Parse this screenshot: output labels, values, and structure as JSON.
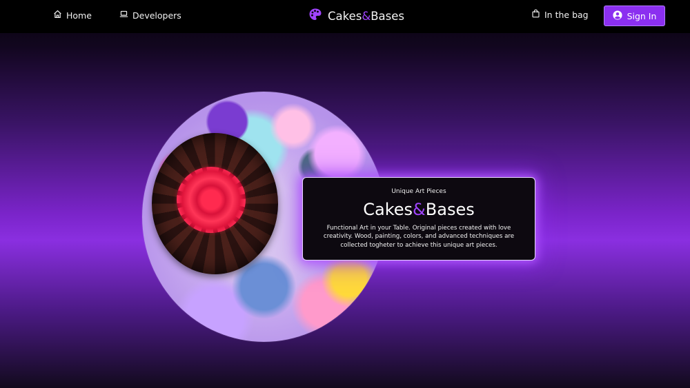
{
  "nav": {
    "home_label": "Home",
    "developers_label": "Developers",
    "bag_label": "In the bag",
    "signin_label": "Sign In"
  },
  "brand": {
    "part1": "Cakes",
    "amp": "&",
    "part2": "Bases"
  },
  "hero_card": {
    "eyebrow": "Unique Art Pieces",
    "title_part1": "Cakes",
    "title_amp": "&",
    "title_part2": "Bases",
    "description": "Functional Art in your Table. Original pieces created with love creativity. Wood, painting, colors, and advanced techniques are collected togheter to achieve this unique art pieces."
  },
  "colors": {
    "accent": "#8b2ff0",
    "amp": "#a044ff",
    "nav_bg": "#000000"
  },
  "icons": {
    "home": "home-icon",
    "developers": "laptop-icon",
    "brand": "palette-icon",
    "bag": "shopping-bag-icon",
    "signin": "user-circle-icon"
  }
}
